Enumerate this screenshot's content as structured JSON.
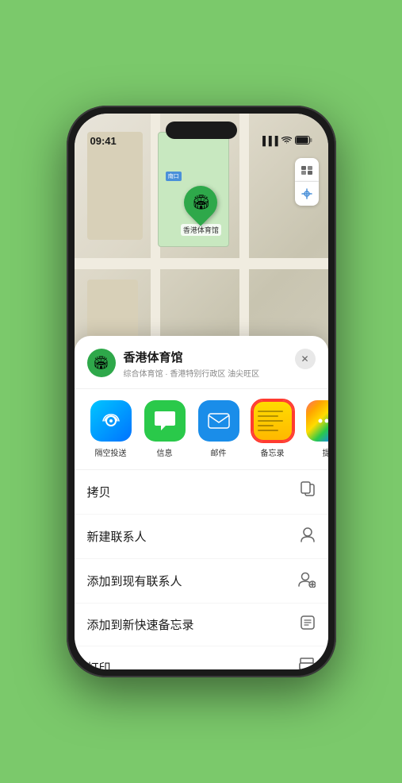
{
  "status": {
    "time": "09:41",
    "signal": "▐▐▐",
    "wifi": "WiFi",
    "battery": "Battery"
  },
  "map": {
    "label_box": "南口",
    "stadium_label": "香港体育馆"
  },
  "place": {
    "name": "香港体育馆",
    "description": "综合体育馆 · 香港特别行政区 油尖旺区",
    "icon": "🏟"
  },
  "share_items": [
    {
      "id": "airdrop",
      "label": "隔空投送",
      "type": "airdrop"
    },
    {
      "id": "messages",
      "label": "信息",
      "type": "messages"
    },
    {
      "id": "mail",
      "label": "邮件",
      "type": "mail"
    },
    {
      "id": "notes",
      "label": "备忘录",
      "type": "notes",
      "selected": true
    },
    {
      "id": "more",
      "label": "提",
      "type": "more"
    }
  ],
  "actions": [
    {
      "id": "copy",
      "label": "拷贝",
      "icon": "⎘"
    },
    {
      "id": "new-contact",
      "label": "新建联系人",
      "icon": "👤"
    },
    {
      "id": "add-existing",
      "label": "添加到现有联系人",
      "icon": "👤+"
    },
    {
      "id": "add-note",
      "label": "添加到新快速备忘录",
      "icon": "📋"
    },
    {
      "id": "print",
      "label": "打印",
      "icon": "🖨"
    }
  ],
  "close_label": "✕"
}
